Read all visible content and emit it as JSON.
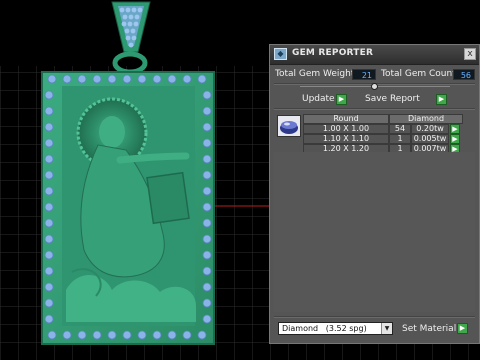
{
  "panel": {
    "title": "GEM REPORTER",
    "title_icon": "gem-reporter-icon",
    "close_label": "x",
    "total_weight_label": "Total Gem Weight",
    "total_weight_value": "21",
    "total_count_label": "Total Gem Count",
    "total_count_value": "56",
    "update_label": "Update",
    "save_report_label": "Save Report",
    "go_arrow": "▶",
    "table": {
      "headers": [
        "Round",
        "Diamond"
      ],
      "rows": [
        {
          "size": "1.00 X 1.00",
          "count": "54",
          "weight": "0.20tw"
        },
        {
          "size": "1.10 X 1.10",
          "count": "1",
          "weight": "0.005tw"
        },
        {
          "size": "1.20 X 1.20",
          "count": "1",
          "weight": "0.007tw"
        }
      ]
    },
    "material": {
      "name": "Diamond",
      "spg": "(3.52 spg)",
      "set_label": "Set Material"
    }
  },
  "colors": {
    "pendant_green": "#35a07a",
    "gem_blue": "#8ab4e8",
    "grid_line": "#2c2c2c",
    "axis_red": "#b81e1e",
    "accent_go": "#3fa84a",
    "value_text": "#6ab4ff"
  }
}
